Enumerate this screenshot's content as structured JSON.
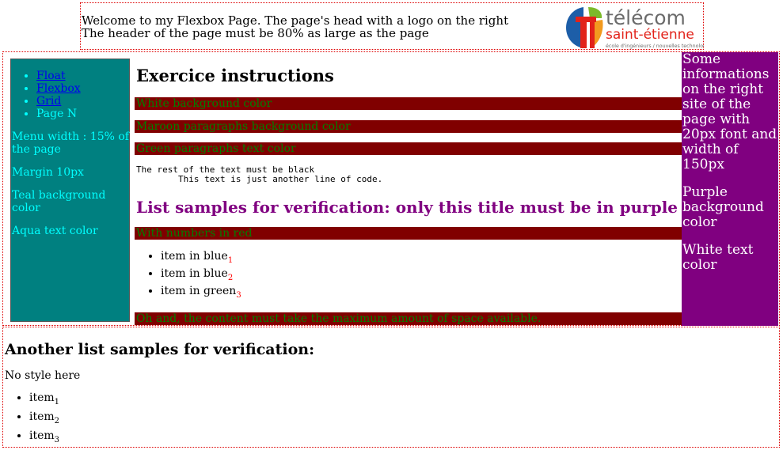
{
  "header": {
    "line1": "Welcome to my Flexbox Page. The page's head with a logo on the right",
    "line2": "The header of the page must be 80% as large as the page",
    "logo": {
      "word1": "télécom",
      "word2": "saint-étienne",
      "tagline": "école d'ingénieurs / nouvelles technologies",
      "colors": {
        "red": "#e2231a",
        "blue": "#1d5ea8",
        "green": "#7cba2a",
        "orange": "#f29a1f",
        "gray": "#6b6b6b"
      }
    }
  },
  "menu": {
    "items": [
      {
        "label": "Float",
        "link": true
      },
      {
        "label": "Flexbox",
        "link": true
      },
      {
        "label": "Grid",
        "link": true
      },
      {
        "label": "Page N",
        "link": false
      }
    ],
    "notes": [
      "Menu width : 15% of the page",
      "Margin 10px",
      "Teal background color",
      "Aqua text color"
    ]
  },
  "content": {
    "title": "Exercice instructions",
    "instructions": [
      "White background color",
      "Maroon paragraphs background color",
      "Green paragraphs text color"
    ],
    "code_line1": "The rest of the text must be black",
    "code_line2": "\tThis text is just another line of code.",
    "list_title": "List samples for verification: only this title must be in purple",
    "numbers_note": "With numbers in red",
    "items": [
      {
        "label": "item in blue",
        "num": "1"
      },
      {
        "label": "item in blue",
        "num": "2"
      },
      {
        "label": "item in green",
        "num": "3"
      }
    ],
    "final_note": "Oh and, the content must take the maximum amount of space available."
  },
  "aside": {
    "paragraphs": [
      "Some informations on the right site of the page with 20px font and width of 150px",
      "Purple background color",
      "White text color"
    ]
  },
  "footer": {
    "title": "Another list samples for verification:",
    "note": "No style here",
    "items": [
      {
        "label": "item",
        "num": "1"
      },
      {
        "label": "item",
        "num": "2"
      },
      {
        "label": "item",
        "num": "3"
      }
    ]
  }
}
